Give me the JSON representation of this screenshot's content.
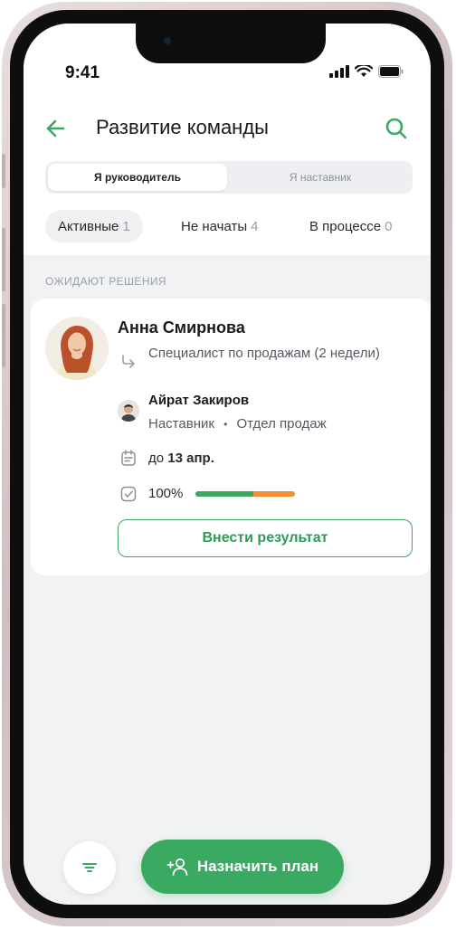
{
  "status_bar": {
    "time": "9:41"
  },
  "header": {
    "title": "Развитие команды",
    "back_icon": "arrow-left-icon",
    "search_icon": "search-icon"
  },
  "role_toggle": {
    "options": [
      "Я руководитель",
      "Я наставник"
    ],
    "selected": "Я руководитель"
  },
  "filter_tabs": [
    {
      "label": "Активные",
      "count": "1",
      "active": true
    },
    {
      "label": "Не начаты",
      "count": "4",
      "active": false
    },
    {
      "label": "В процессе",
      "count": "0",
      "active": false
    }
  ],
  "section": {
    "label": "ОЖИДАЮТ РЕШЕНИЯ"
  },
  "card": {
    "name": "Анна Смирнова",
    "role": "Специалист по продажам (2 недели)",
    "mentor_name": "Айрат Закиров",
    "mentor_role": "Наставник",
    "mentor_separator": "•",
    "mentor_department": "Отдел продаж",
    "deadline_prefix": "до",
    "deadline_date": "13 апр.",
    "progress_label": "100%",
    "progress": {
      "green_fraction": 0.58,
      "orange_fraction": 0.42
    },
    "button_label": "Внести результат"
  },
  "actions": {
    "assign_label": "Назначить план",
    "filter_icon": "filter-icon",
    "assign_icon": "add-user-icon"
  },
  "colors": {
    "accent": "#3aaa63",
    "progress_orange": "#f28f36",
    "background": "#f1f2f4"
  }
}
